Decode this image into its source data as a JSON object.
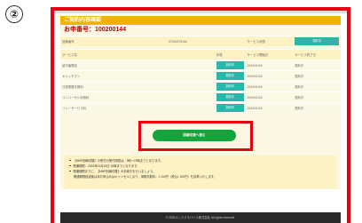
{
  "step_number": "②",
  "page": {
    "title": "ご契約内容確認",
    "application_number_label": "お申番号：100200144"
  },
  "summary": {
    "left_label": "回線番号",
    "left_value": "07044375154",
    "right_label": "サービス状態",
    "right_badge": "契約中"
  },
  "table": {
    "headers": [
      "サービス名",
      "状態",
      "サービス開始日",
      "サービス終了日"
    ],
    "rows": [
      {
        "name": "留守番電話",
        "badge": "契約中",
        "start": "2024/01/16",
        "end": "契約中"
      },
      {
        "name": "キャッチホン",
        "badge": "契約中",
        "start": "2024/01/16",
        "end": "契約中"
      },
      {
        "name": "口座振替手数料",
        "badge": "契約中",
        "start": "2024/01/16",
        "end": "契約中"
      },
      {
        "name": "ユニバーサル利用料",
        "badge": "契約中",
        "start": "2024/01/16",
        "end": "契約中"
      },
      {
        "name": "リレーサービス料",
        "badge": "契約中",
        "start": "2024/01/16",
        "end": "契約中"
      }
    ]
  },
  "cta": {
    "button_label": "回線切替へ進む"
  },
  "notes": [
    {
      "text": "【MNP回線切替】の受付の受付時間は、9時～19時までとなります。",
      "indent": false
    },
    {
      "text": "開通期限：2024年01月24日 19時までとなります。",
      "indent": false
    },
    {
      "text": "開通期限までに、【MNP回線切替】の手続きを行いましょう。",
      "indent": false
    },
    {
      "text": "開通期限経過後は本お申込みはキャンセルとなり、事務手数料：1,100円（税込1,100円）を請求いたします。",
      "indent": true
    }
  ],
  "footer": {
    "copyright": "© 2024エックスモバイル株式会社 All rights reserved."
  },
  "colors": {
    "highlight_outline": "#e60012",
    "title_bar": "#f1b200",
    "status_badge": "#2ab6a8",
    "cta_button": "#13a53c",
    "panel_background": "#fbf7e2"
  }
}
